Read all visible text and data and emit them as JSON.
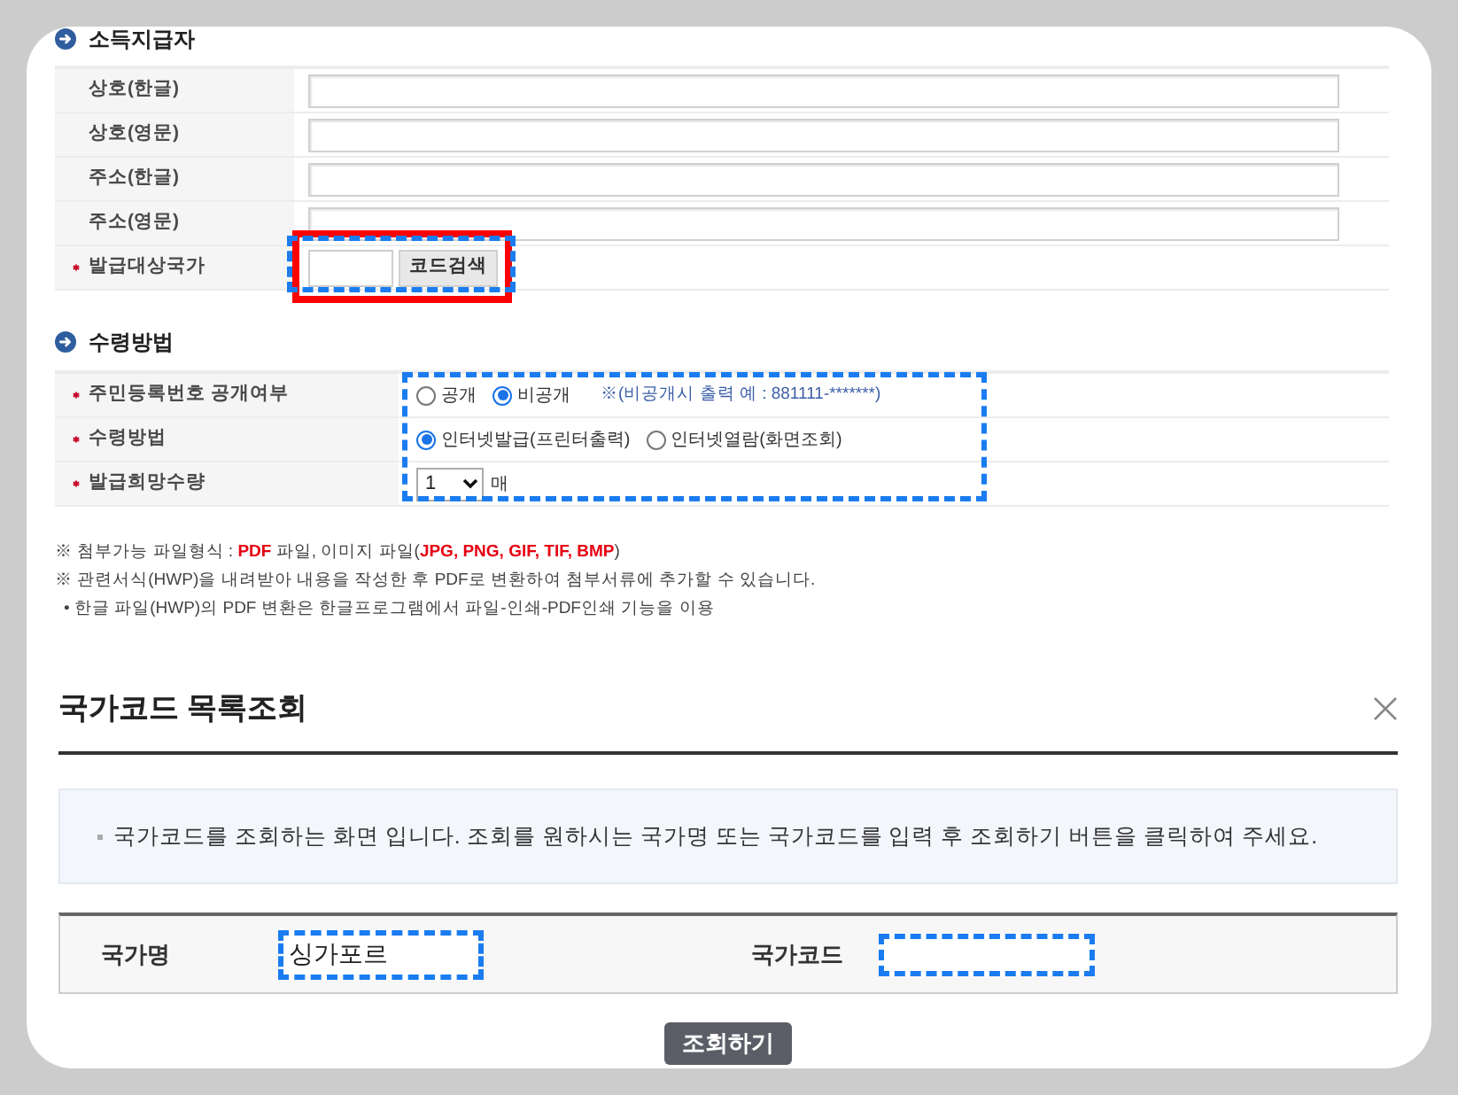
{
  "income_payer": {
    "title": "소득지급자",
    "rows": [
      {
        "label": "상호(한글)",
        "required": false,
        "kind": "text"
      },
      {
        "label": "상호(영문)",
        "required": false,
        "kind": "text"
      },
      {
        "label": "주소(한글)",
        "required": false,
        "kind": "text"
      },
      {
        "label": "주소(영문)",
        "required": false,
        "kind": "text"
      },
      {
        "label": "발급대상국가",
        "required": true,
        "kind": "code-search",
        "button": "코드검색",
        "highlighted": true,
        "outlined": true
      }
    ]
  },
  "receipt_method": {
    "title": "수령방법",
    "outlined": true,
    "rows": [
      {
        "label": "주민등록번호 공개여부",
        "required": true,
        "kind": "radio",
        "options": [
          {
            "label": "공개",
            "selected": false
          },
          {
            "label": "비공개",
            "selected": true
          }
        ],
        "note": "※(비공개시 출력 예 : 881111-*******)"
      },
      {
        "label": "수령방법",
        "required": true,
        "kind": "radio",
        "options": [
          {
            "label": "인터넷발급(프린터출력)",
            "selected": true
          },
          {
            "label": "인터넷열람(화면조회)",
            "selected": false
          }
        ]
      },
      {
        "label": "발급희망수량",
        "required": true,
        "kind": "select",
        "value": "1",
        "unit": "매"
      }
    ]
  },
  "notes": [
    {
      "kind": "main",
      "segments": [
        {
          "text": "※ 첨부가능 파일형식 : ",
          "emphasis": false
        },
        {
          "text": "PDF",
          "emphasis": true
        },
        {
          "text": " 파일, 이미지 파일(",
          "emphasis": false
        },
        {
          "text": "JPG, PNG, GIF, TIF, BMP",
          "emphasis": true
        },
        {
          "text": ")",
          "emphasis": false
        }
      ]
    },
    {
      "kind": "main",
      "segments": [
        {
          "text": "※ 관련서식(HWP)을 내려받아 내용을 작성한 후 PDF로 변환하여 첨부서류에 추가할 수 있습니다.",
          "emphasis": false
        }
      ]
    },
    {
      "kind": "sub",
      "segments": [
        {
          "text": "• 한글 파일(HWP)의 PDF 변환은 한글프로그램에서 파일-인쇄-PDF인쇄 기능을 이용",
          "emphasis": false
        }
      ]
    }
  ],
  "dialog": {
    "title": "국가코드 목록조회",
    "info": "국가코드를 조회하는 화면 입니다. 조회를 원하시는 국가명 또는 국가코드를 입력 후 조회하기 버튼을 클릭하여 주세요.",
    "fields": [
      {
        "label": "국가명",
        "value": "싱가포르",
        "outlined": true
      },
      {
        "label": "국가코드",
        "outlined": true
      }
    ],
    "button": "조회하기"
  }
}
